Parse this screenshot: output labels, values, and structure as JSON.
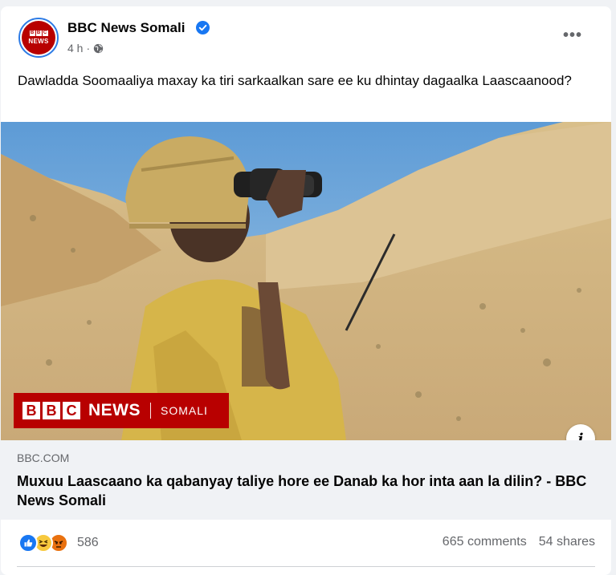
{
  "post": {
    "page_name": "BBC News Somali",
    "time": "4 h",
    "privacy_icon": "globe-icon",
    "verified_icon": "verified-badge-icon",
    "more_label": "•••",
    "text": "Dawladda Soomaaliya maxay ka tiri sarkaalkan sare ee ku dhintay dagaalka Laascaanood?"
  },
  "avatar": {
    "blocks": [
      "B",
      "B",
      "C"
    ],
    "label": "NEWS"
  },
  "image": {
    "banner": {
      "blocks": [
        "B",
        "B",
        "C"
      ],
      "news": "NEWS",
      "section": "SOMALI"
    },
    "info_label": "i"
  },
  "link": {
    "domain": "BBC.COM",
    "title": "Muxuu Laascaano ka qabanyay taliye hore ee Danab ka hor inta aan la dilin? - BBC News Somali"
  },
  "engagement": {
    "reaction_icons": [
      "like-icon",
      "haha-icon",
      "angry-icon"
    ],
    "reaction_count": "586",
    "comments": "665 comments",
    "shares": "54 shares"
  },
  "colors": {
    "bbc_red": "#b80000",
    "facebook_blue": "#1877f2",
    "secondary_text": "#65676b"
  }
}
